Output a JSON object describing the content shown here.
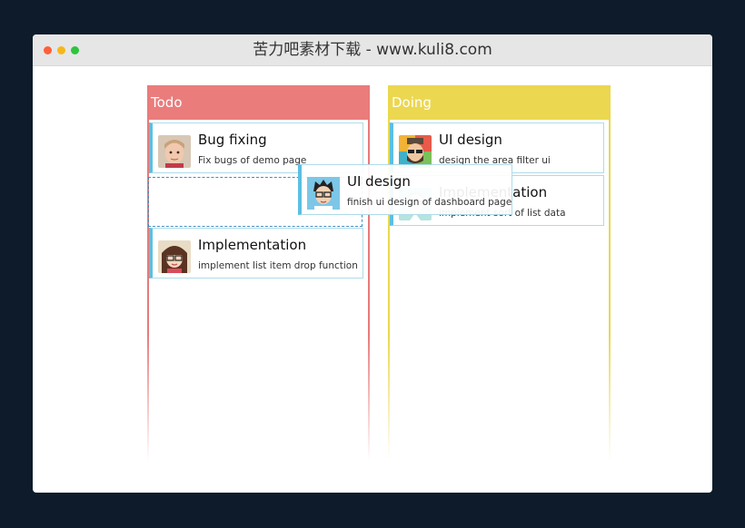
{
  "window": {
    "title": "苦力吧素材下载 - www.kuli8.com"
  },
  "board": {
    "columns": [
      {
        "title": "Todo",
        "cards": [
          {
            "name": "Bug fixing",
            "desc": "Fix bugs of demo page",
            "avatar": "child-photo-avatar"
          },
          {
            "name": "Implementation",
            "desc": "implement list item drop function",
            "avatar": "girl-glasses-avatar"
          }
        ]
      },
      {
        "title": "Doing",
        "cards": [
          {
            "name": "UI design",
            "desc": "design the area filter ui",
            "avatar": "bearded-man-avatar"
          },
          {
            "name": "Implementation",
            "desc": "implement sort of list data",
            "avatar": "man-glasses-avatar"
          }
        ]
      }
    ],
    "dragging_card": {
      "name": "UI design",
      "desc": "finish ui design of dashboard page",
      "avatar": "boy-glasses-avatar"
    }
  },
  "colors": {
    "todo": "#ea7c7c",
    "doing": "#ecd751",
    "card_accent": "#5bbfe2",
    "background": "#0d1b2a"
  }
}
